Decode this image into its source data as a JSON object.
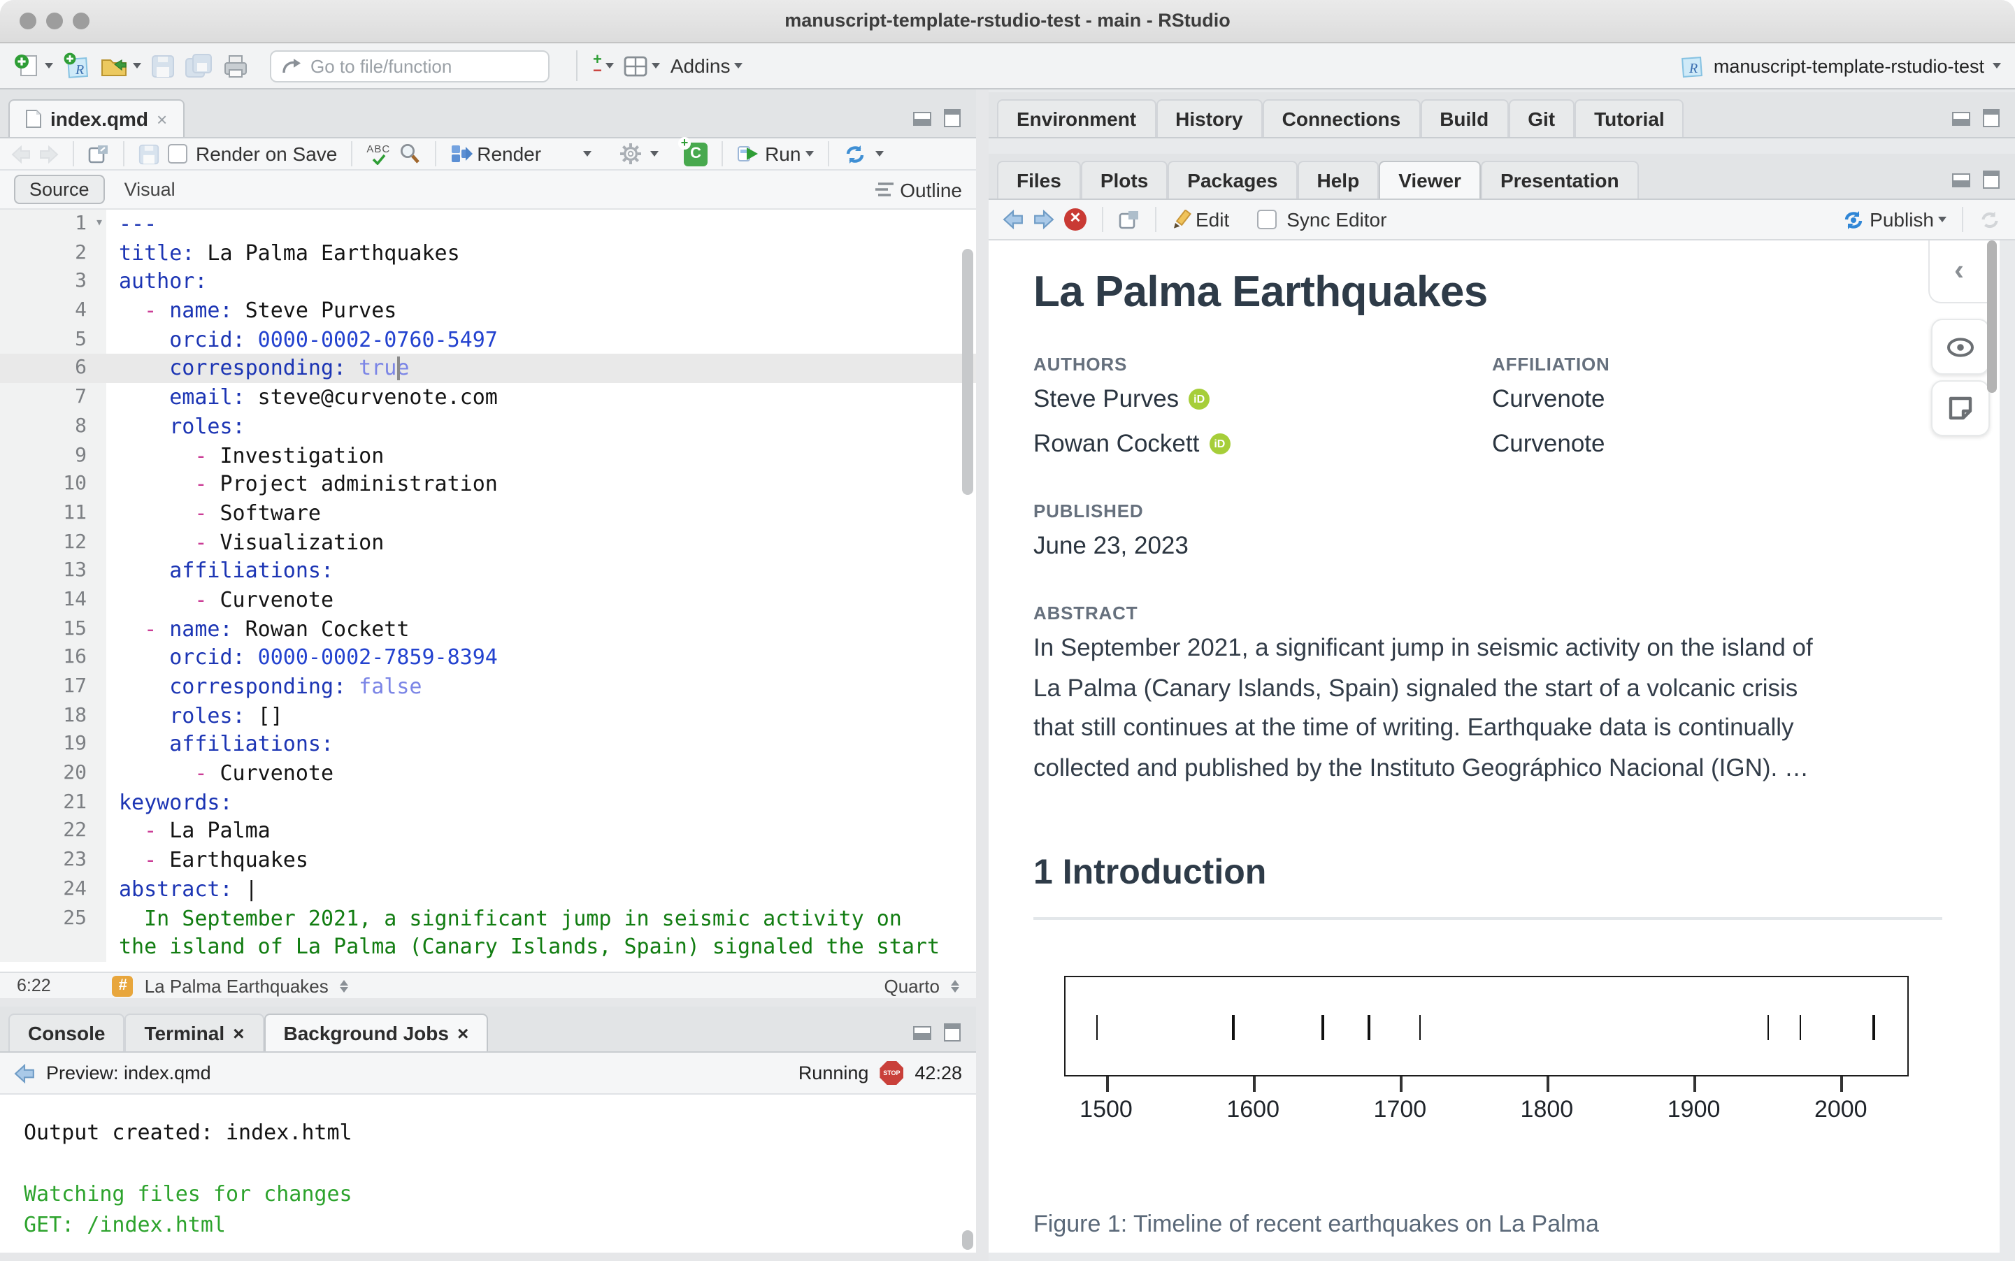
{
  "window": {
    "title": "manuscript-template-rstudio-test - main - RStudio"
  },
  "toolbar": {
    "goto_placeholder": "Go to file/function",
    "addins_label": "Addins",
    "project_name": "manuscript-template-rstudio-test"
  },
  "editor": {
    "tab_label": "index.qmd",
    "toolbar": {
      "render_on_save": "Render on Save",
      "render": "Render",
      "run": "Run"
    },
    "mode": {
      "source": "Source",
      "visual": "Visual",
      "outline": "Outline"
    },
    "status": {
      "cursor": "6:22",
      "section": "La Palma Earthquakes",
      "format": "Quarto"
    },
    "lines": [
      {
        "n": 1,
        "fold": true,
        "segs": [
          [
            "key",
            "---"
          ]
        ]
      },
      {
        "n": 2,
        "segs": [
          [
            "key",
            "title:"
          ],
          [
            "plain",
            " La Palma Earthquakes"
          ]
        ]
      },
      {
        "n": 3,
        "segs": [
          [
            "key",
            "author:"
          ]
        ]
      },
      {
        "n": 4,
        "segs": [
          [
            "plain",
            "  "
          ],
          [
            "dash",
            "- "
          ],
          [
            "key",
            "name:"
          ],
          [
            "plain",
            " Steve Purves"
          ]
        ]
      },
      {
        "n": 5,
        "segs": [
          [
            "plain",
            "    "
          ],
          [
            "key",
            "orcid:"
          ],
          [
            "num",
            " 0000-0002-0760-5497"
          ]
        ]
      },
      {
        "n": 6,
        "hl": true,
        "cursor_ch": 22,
        "segs": [
          [
            "plain",
            "    "
          ],
          [
            "key",
            "corresponding:"
          ],
          [
            "bool",
            " true"
          ]
        ]
      },
      {
        "n": 7,
        "segs": [
          [
            "plain",
            "    "
          ],
          [
            "key",
            "email:"
          ],
          [
            "plain",
            " steve@curvenote.com"
          ]
        ]
      },
      {
        "n": 8,
        "segs": [
          [
            "plain",
            "    "
          ],
          [
            "key",
            "roles:"
          ]
        ]
      },
      {
        "n": 9,
        "segs": [
          [
            "plain",
            "      "
          ],
          [
            "dash",
            "- "
          ],
          [
            "plain",
            "Investigation"
          ]
        ]
      },
      {
        "n": 10,
        "segs": [
          [
            "plain",
            "      "
          ],
          [
            "dash",
            "- "
          ],
          [
            "plain",
            "Project administration"
          ]
        ]
      },
      {
        "n": 11,
        "segs": [
          [
            "plain",
            "      "
          ],
          [
            "dash",
            "- "
          ],
          [
            "plain",
            "Software"
          ]
        ]
      },
      {
        "n": 12,
        "segs": [
          [
            "plain",
            "      "
          ],
          [
            "dash",
            "- "
          ],
          [
            "plain",
            "Visualization"
          ]
        ]
      },
      {
        "n": 13,
        "segs": [
          [
            "plain",
            "    "
          ],
          [
            "key",
            "affiliations:"
          ]
        ]
      },
      {
        "n": 14,
        "segs": [
          [
            "plain",
            "      "
          ],
          [
            "dash",
            "- "
          ],
          [
            "plain",
            "Curvenote"
          ]
        ]
      },
      {
        "n": 15,
        "segs": [
          [
            "plain",
            "  "
          ],
          [
            "dash",
            "- "
          ],
          [
            "key",
            "name:"
          ],
          [
            "plain",
            " Rowan Cockett"
          ]
        ]
      },
      {
        "n": 16,
        "segs": [
          [
            "plain",
            "    "
          ],
          [
            "key",
            "orcid:"
          ],
          [
            "num",
            " 0000-0002-7859-8394"
          ]
        ]
      },
      {
        "n": 17,
        "segs": [
          [
            "plain",
            "    "
          ],
          [
            "key",
            "corresponding:"
          ],
          [
            "bool",
            " false"
          ]
        ]
      },
      {
        "n": 18,
        "segs": [
          [
            "plain",
            "    "
          ],
          [
            "key",
            "roles:"
          ],
          [
            "plain",
            " []"
          ]
        ]
      },
      {
        "n": 19,
        "segs": [
          [
            "plain",
            "    "
          ],
          [
            "key",
            "affiliations:"
          ]
        ]
      },
      {
        "n": 20,
        "segs": [
          [
            "plain",
            "      "
          ],
          [
            "dash",
            "- "
          ],
          [
            "plain",
            "Curvenote"
          ]
        ]
      },
      {
        "n": 21,
        "segs": [
          [
            "key",
            "keywords:"
          ]
        ]
      },
      {
        "n": 22,
        "segs": [
          [
            "plain",
            "  "
          ],
          [
            "dash",
            "- "
          ],
          [
            "plain",
            "La Palma"
          ]
        ]
      },
      {
        "n": 23,
        "segs": [
          [
            "plain",
            "  "
          ],
          [
            "dash",
            "- "
          ],
          [
            "plain",
            "Earthquakes"
          ]
        ]
      },
      {
        "n": 24,
        "segs": [
          [
            "key",
            "abstract:"
          ],
          [
            "plain",
            " |"
          ]
        ]
      },
      {
        "n": 25,
        "segs": [
          [
            "str",
            "  In September 2021, a significant jump in seismic activity on"
          ]
        ]
      },
      {
        "n": null,
        "segs": [
          [
            "str",
            "the island of La Palma (Canary Islands, Spain) signaled the start"
          ]
        ]
      }
    ]
  },
  "console": {
    "tabs": [
      {
        "label": "Console"
      },
      {
        "label": "Terminal",
        "closable": true
      },
      {
        "label": "Background Jobs",
        "closable": true,
        "active": true
      }
    ],
    "job": {
      "label": "Preview: index.qmd",
      "status": "Running",
      "stop": "STOP",
      "elapsed": "42:28"
    },
    "output": [
      {
        "text": "Output created: index.html",
        "cls": "plain"
      },
      {
        "text": "",
        "cls": "plain"
      },
      {
        "text": "Watching files for changes",
        "cls": "green"
      },
      {
        "text": "GET: /index.html",
        "cls": "green"
      }
    ]
  },
  "right_panel": {
    "top_tabs": [
      {
        "label": "Environment"
      },
      {
        "label": "History"
      },
      {
        "label": "Connections"
      },
      {
        "label": "Build"
      },
      {
        "label": "Git"
      },
      {
        "label": "Tutorial"
      }
    ],
    "bottom_tabs": [
      {
        "label": "Files"
      },
      {
        "label": "Plots"
      },
      {
        "label": "Packages"
      },
      {
        "label": "Help"
      },
      {
        "label": "Viewer",
        "active": true
      },
      {
        "label": "Presentation"
      }
    ],
    "viewer_toolbar": {
      "edit": "Edit",
      "sync_editor": "Sync Editor",
      "publish": "Publish"
    }
  },
  "document": {
    "title": "La Palma Earthquakes",
    "authors_label": "AUTHORS",
    "affiliation_label": "AFFILIATION",
    "authors": [
      {
        "name": "Steve Purves",
        "affiliation": "Curvenote"
      },
      {
        "name": "Rowan Cockett",
        "affiliation": "Curvenote"
      }
    ],
    "published_label": "PUBLISHED",
    "published": "June 23, 2023",
    "abstract_label": "ABSTRACT",
    "abstract_lines": [
      "In September 2021, a significant jump in seismic activity on the island of",
      "La Palma (Canary Islands, Spain) signaled the start of a volcanic crisis",
      "that still continues at the time of writing. Earthquake data is continually",
      "collected and published by the Instituto Geográphico Nacional (IGN). …"
    ],
    "section_heading": "1 Introduction"
  },
  "chart_data": {
    "type": "eventplot",
    "title": "Timeline of recent earthquakes on La Palma",
    "events": [
      1492,
      1585,
      1646,
      1677,
      1712,
      1949,
      1971,
      2021
    ],
    "x_ticks": [
      1500,
      1600,
      1700,
      1800,
      1900,
      2000
    ],
    "xlim": [
      1471.4,
      2046.3
    ],
    "grid": false,
    "caption": "Figure 1: Timeline of recent earthquakes on La Palma"
  },
  "colors": {
    "accent_blue": "#3f8fd4",
    "orcid_green": "#a6ce39",
    "stop_red": "#c9403a",
    "console_green": "#2da32d",
    "yaml_key": "#1c35b4",
    "yaml_bool": "#7b85e6",
    "yaml_dash": "#cb3d96",
    "yaml_string": "#127d12",
    "chunk_green": "#48a94e"
  }
}
